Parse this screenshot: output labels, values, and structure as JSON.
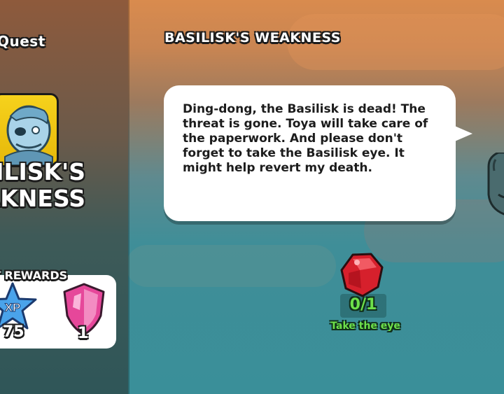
{
  "colors": {
    "panel_top": "#8e5a3c",
    "panel_bottom": "#2f5658",
    "portrait_frame": "#f6d21c",
    "objective_green": "#6de04a",
    "bubble": "#ffffff"
  },
  "sidebar": {
    "title": "Quest",
    "portrait_icon": "pirate-zombie-portrait-icon",
    "quest_name_line1": "ILISK'S",
    "quest_name_line2": "AKNESS",
    "rewards_label": "T REWARDS",
    "rewards": [
      {
        "icon": "xp-star-icon",
        "value": "75"
      },
      {
        "icon": "pink-gem-shield-icon",
        "value": "1"
      }
    ]
  },
  "main": {
    "title": "BASILISK'S WEAKNESS",
    "dialogue": "Ding-dong, the Basilisk is dead! The threat is gone. Toya will take care of the paperwork. And please don't forget to take the Basilisk eye. It might help revert my death.",
    "objective": {
      "icon": "red-gem-icon",
      "progress": "0/1",
      "label": "Take the eye"
    },
    "npc_icon": "npc-character-icon"
  }
}
